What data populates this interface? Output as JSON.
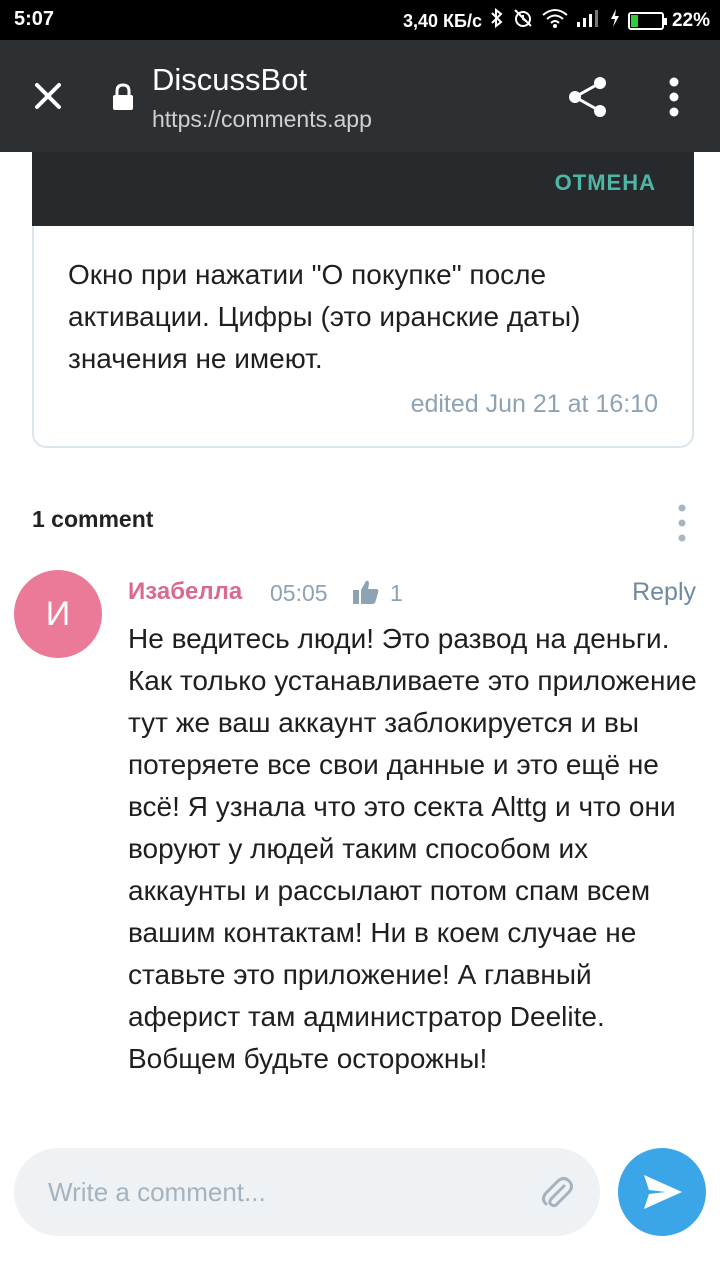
{
  "status_bar": {
    "time": "5:07",
    "speed": "3,40 КБ/с",
    "battery": "22%",
    "battery_level": 0.22
  },
  "app_bar": {
    "title": "DiscussBot",
    "url": "https://comments.app"
  },
  "dialog": {
    "cancel_label": "ОТМЕНА"
  },
  "message": {
    "text": "Окно при нажатии \"О покупке\" после активации. Цифры (это иранские даты) значения не имеют.",
    "edited": "edited  Jun 21 at 16:10"
  },
  "comments": {
    "count_label": "1 comment",
    "items": [
      {
        "avatar_letter": "И",
        "author": "Изабелла",
        "time": "05:05",
        "likes": "1",
        "reply_label": "Reply",
        "text": "Не ведитесь люди! Это развод на деньги. Как только устанавливаете это приложение тут же ваш аккаунт заблокируется и вы потеряете все свои данные и это ещё не всё! Я узнала что это секта Alttg и что они воруют у людей таким способом их аккаунты и рассылают потом спам всем вашим контактам! Ни в коем случае не ставьте это приложение! А главный аферист там администратор Deelite. Вобщем будьте осторожны!"
      }
    ]
  },
  "composer": {
    "placeholder": "Write a comment..."
  },
  "colors": {
    "app_bar": "#2d3033",
    "accent_teal": "#4fb6a6",
    "author_pink": "#d96a8e",
    "avatar_pink": "#ea7a98",
    "send_blue": "#3aa6e8"
  }
}
